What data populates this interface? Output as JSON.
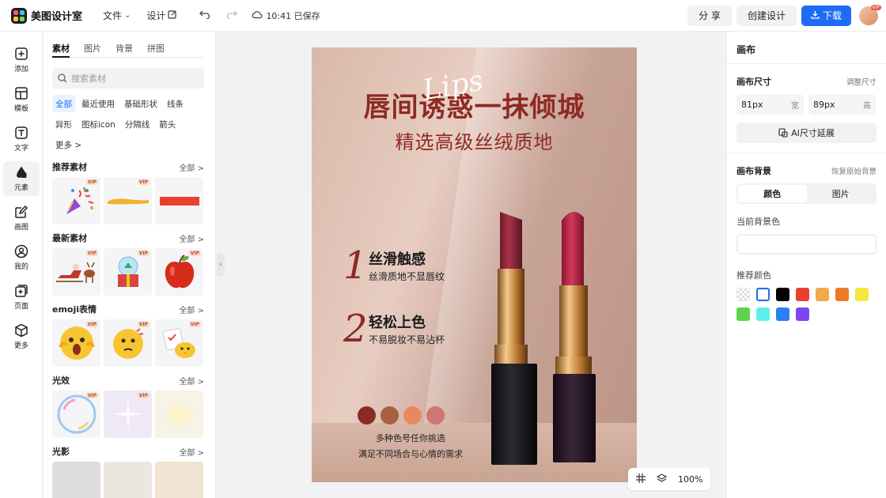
{
  "app": {
    "name": "美图设计室",
    "save_status": "10:41 已保存"
  },
  "topbar": {
    "file_label": "文件",
    "design_label": "设计",
    "share_label": "分 享",
    "create_label": "创建设计",
    "download_label": "下载",
    "avatar_badge": "VIP"
  },
  "rail": {
    "items": [
      {
        "label": "添加",
        "icon": "plus-square-icon"
      },
      {
        "label": "模板",
        "icon": "template-icon"
      },
      {
        "label": "文字",
        "icon": "text-icon"
      },
      {
        "label": "元素",
        "icon": "shapes-icon"
      },
      {
        "label": "画图",
        "icon": "draw-icon"
      },
      {
        "label": "我的",
        "icon": "user-icon"
      },
      {
        "label": "页面",
        "icon": "page-add-icon"
      },
      {
        "label": "更多",
        "icon": "cube-icon"
      }
    ],
    "active": "元素"
  },
  "left_panel": {
    "tabs": [
      "素材",
      "图片",
      "背景",
      "拼图"
    ],
    "active_tab": "素材",
    "search_placeholder": "搜索素材",
    "chips": [
      "全部",
      "最近使用",
      "基础形状",
      "线条",
      "异形",
      "图标icon",
      "分隔线",
      "箭头",
      "更多 >"
    ],
    "active_chip": "全部",
    "all_label": "全部 >",
    "vip_label": "VIP",
    "sections": [
      {
        "title": "推荐素材"
      },
      {
        "title": "最新素材"
      },
      {
        "title": "emoji表情"
      },
      {
        "title": "光效"
      },
      {
        "title": "光影"
      }
    ]
  },
  "poster": {
    "title": "唇间诱惑一抹倾城",
    "script": "Lips",
    "subtitle": "精选高级丝绒质地",
    "features": [
      {
        "num": "1",
        "title": "丝滑触感",
        "desc": "丝滑质地不显唇纹"
      },
      {
        "num": "2",
        "title": "轻松上色",
        "desc": "不易脱妆不易沾杯"
      }
    ],
    "swatch_colors": [
      "#8b2a24",
      "#a8603f",
      "#e98860",
      "#cd7672"
    ],
    "caption_1": "多种色号任你挑选",
    "caption_2": "满足不同场合与心情的需求"
  },
  "zoom": {
    "level": "100%"
  },
  "right_panel": {
    "title": "画布",
    "size_label": "画布尺寸",
    "resize_link": "调整尺寸",
    "width_value": "81px",
    "width_unit": "宽",
    "height_value": "89px",
    "height_unit": "高",
    "ai_extend_label": "AI尺寸延展",
    "bg_label": "画布背景",
    "bg_restore": "恢复原始背景",
    "bg_tabs": [
      "颜色",
      "图片"
    ],
    "current_bg_label": "当前背景色",
    "recommend_label": "推荐颜色",
    "recommend_colors": [
      "transparent",
      "#ffffff",
      "#000000",
      "#e8402f",
      "#f2a84c",
      "#ec7a2a",
      "#f6e83e",
      "#5bd34a",
      "#5ef0e8",
      "#2d7ef2",
      "#7d45f0"
    ]
  }
}
